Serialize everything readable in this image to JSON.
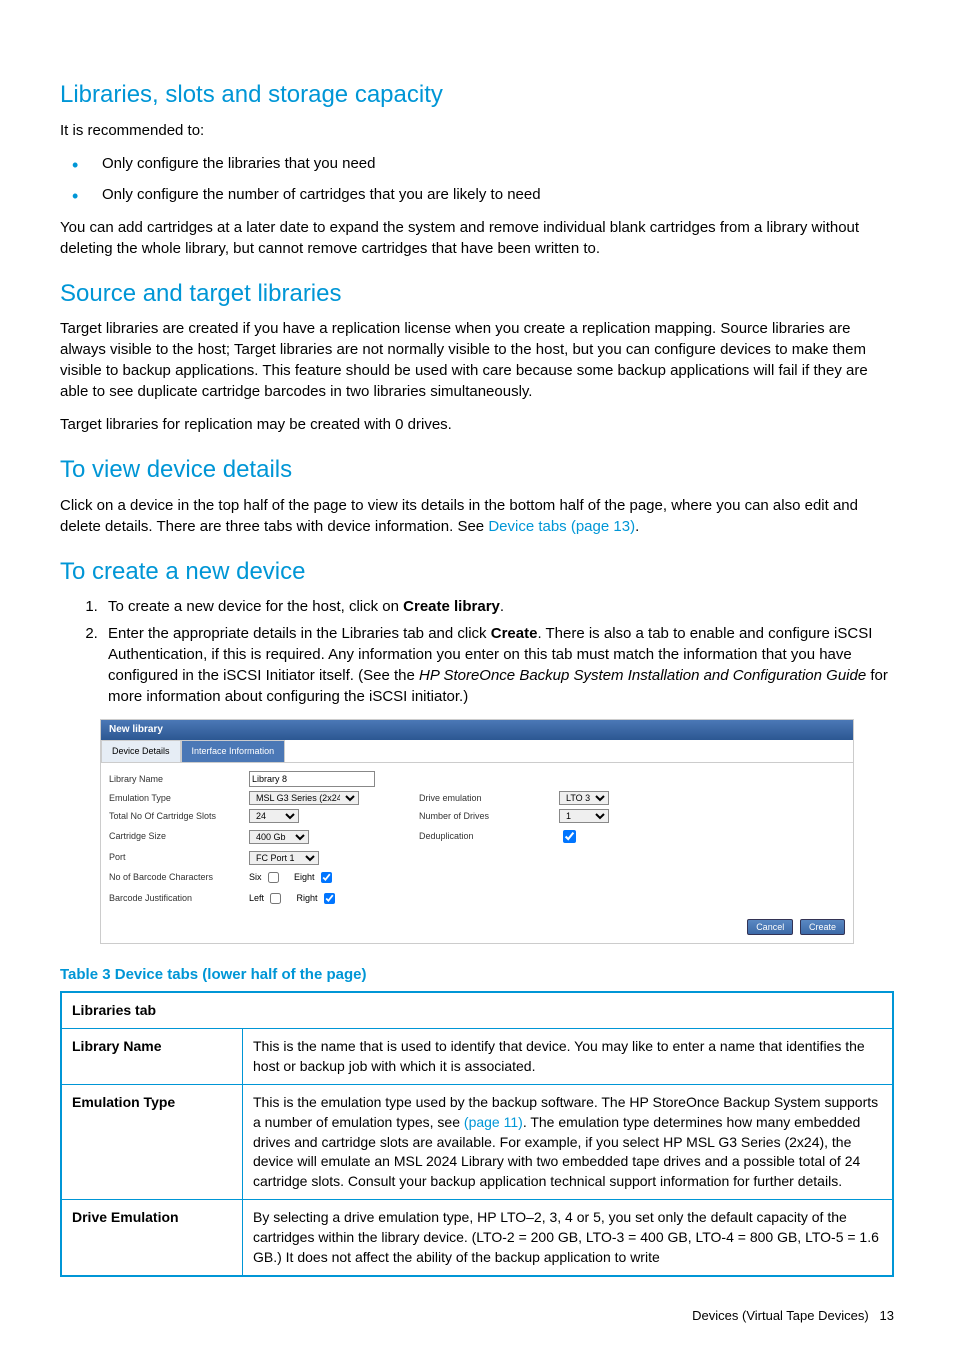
{
  "s1": {
    "title": "Libraries, slots and storage capacity",
    "intro": "It is recommended to:",
    "bullets": [
      "Only configure the libraries that you need",
      "Only configure the number of cartridges that you are likely to need"
    ],
    "after": "You can add cartridges at a later date to expand the system and remove individual blank cartridges from a library without deleting the whole library, but cannot remove cartridges that have been written to."
  },
  "s2": {
    "title": "Source and target libraries",
    "p1": "Target libraries are created if you have a replication license when you create a replication mapping. Source libraries are always visible to the host; Target libraries are not normally visible to the host, but you can configure devices to make them visible to backup applications. This feature should be used with care because some backup applications will fail if they are able to see duplicate cartridge barcodes in two libraries simultaneously.",
    "p2": "Target libraries for replication may be created with 0 drives."
  },
  "s3": {
    "title": "To view device details",
    "p1a": "Click on a device in the top half of the page to view its details in the bottom half of the page, where you can also edit and delete details. There are three tabs with device information. See ",
    "link": "Device tabs (page 13)",
    "p1b": "."
  },
  "s4": {
    "title": "To create a new device",
    "li1_a": "To create a new device for the host, click on ",
    "li1_b": "Create library",
    "li1_c": ".",
    "li2_a": "Enter the appropriate details in the Libraries tab and click ",
    "li2_b": "Create",
    "li2_c": ". There is also a tab to enable and configure iSCSI Authentication, if this is required. Any information you enter on this tab must match the information that you have configured in the iSCSI Initiator itself. (See the ",
    "li2_d": "HP StoreOnce Backup System Installation and Configuration Guide",
    "li2_e": " for more information about configuring the iSCSI initiator.)"
  },
  "newlib": {
    "header": "New library",
    "tab1": "Device Details",
    "tab2": "Interface Information",
    "labels": {
      "libname": "Library Name",
      "emutype": "Emulation Type",
      "slots": "Total No Of Cartridge Slots",
      "cartsize": "Cartridge Size",
      "port": "Port",
      "barcode_chars": "No of Barcode Characters",
      "barcode_just": "Barcode Justification",
      "drive_emu": "Drive emulation",
      "num_drives": "Number of Drives",
      "dedup": "Deduplication",
      "six": "Six",
      "eight": "Eight",
      "left": "Left",
      "right": "Right"
    },
    "values": {
      "libname": "Library 8",
      "emutype": "MSL G3 Series (2x24)",
      "slots": "24",
      "cartsize": "400 Gb",
      "port": "FC Port 1",
      "drive_emu": "LTO 3",
      "num_drives": "1"
    },
    "btn_cancel": "Cancel",
    "btn_create": "Create"
  },
  "table3": {
    "title": "Table 3 Device tabs (lower half of the page)",
    "tabhead": "Libraries tab",
    "rows": [
      {
        "k": "Library Name",
        "v": "This is the name that is used to identify that device. You may like to enter a name that identifies the host or backup job with which it is associated."
      },
      {
        "k": "Emulation Type",
        "v_a": "This is the emulation type used by the backup software. The HP StoreOnce Backup System supports a number of emulation types, see ",
        "link": "(page 11)",
        "v_b": ". The emulation type determines how many embedded drives and cartridge slots are available. For example, if you select HP MSL G3 Series (2x24), the device will emulate an MSL 2024 Library with two embedded tape drives and a possible total of 24 cartridge slots. Consult your backup application technical support information for further details."
      },
      {
        "k": "Drive Emulation",
        "v": "By selecting a drive emulation type, HP LTO–2, 3, 4 or 5, you set only the default capacity of the cartridges within the library device. (LTO-2 = 200 GB, LTO-3 = 400 GB, LTO-4 = 800 GB, LTO-5 = 1.6 GB.) It does not affect the ability of the backup application to write"
      }
    ]
  },
  "footer": {
    "text": "Devices (Virtual Tape Devices)",
    "page": "13"
  }
}
